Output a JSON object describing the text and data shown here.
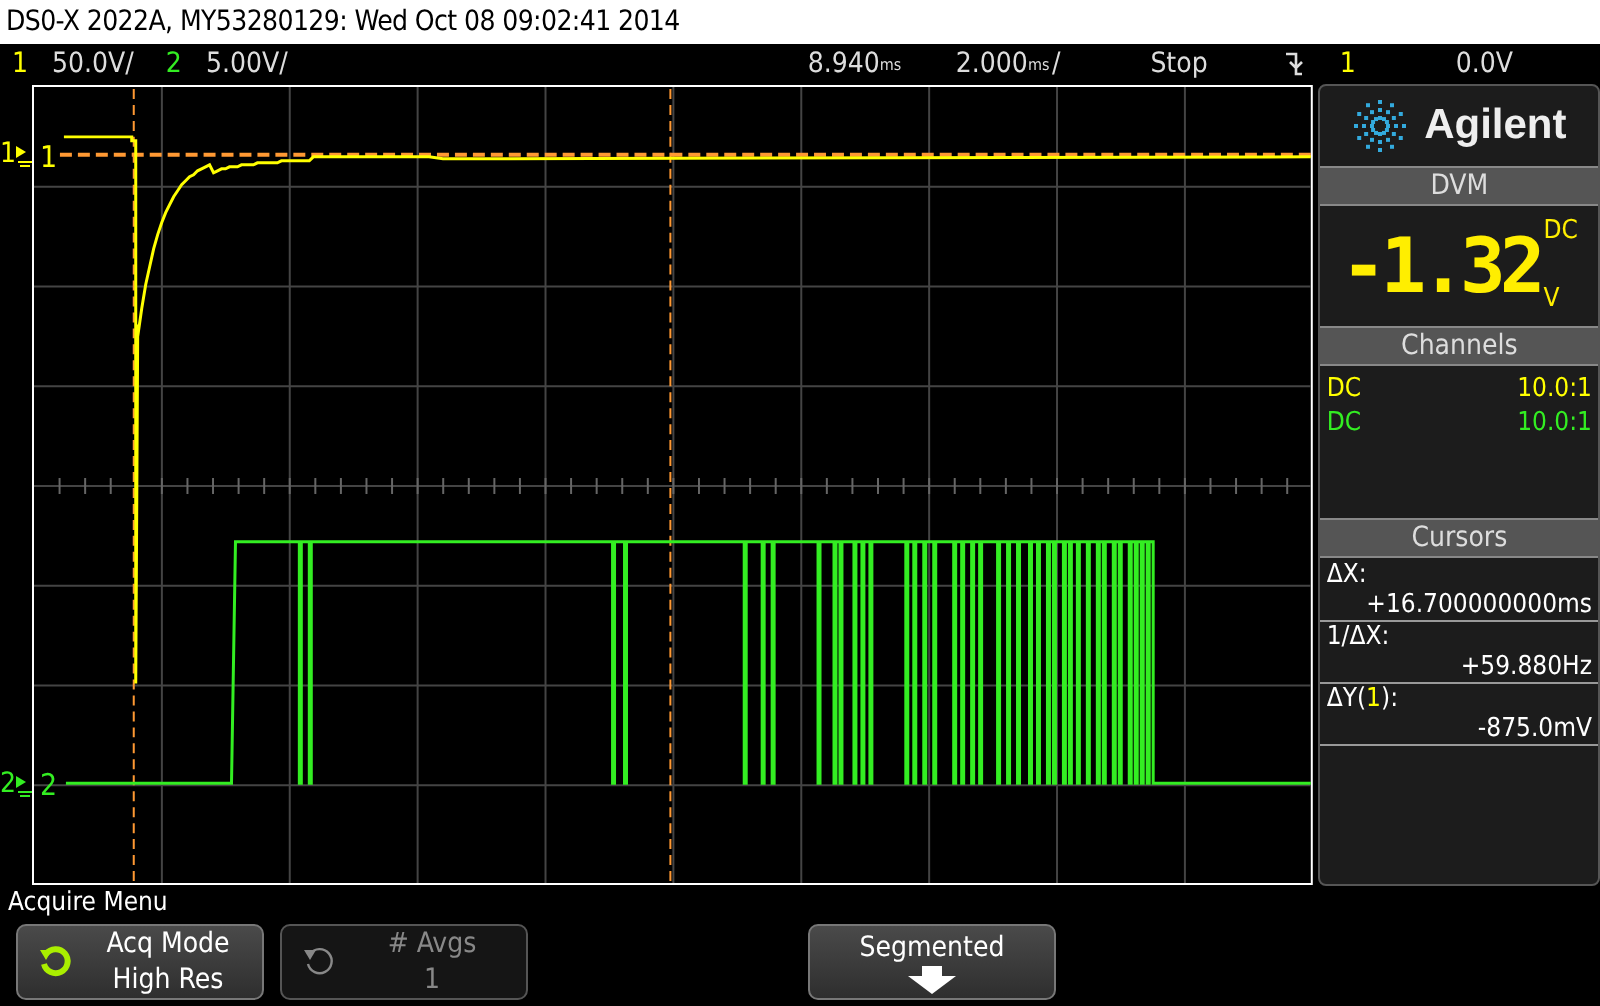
{
  "title_bar": "DS0-X 2022A, MY53280129: Wed Oct 08 09:02:41 2014",
  "status_bar": {
    "channels": [
      {
        "number": "1",
        "scale": "50.0V/",
        "color": "#ffff00"
      },
      {
        "number": "2",
        "scale": "5.00V/",
        "color": "#33ee22"
      }
    ],
    "delay": "8.940",
    "delay_unit": "ms",
    "timebase": "2.000",
    "timebase_unit": "ms",
    "timebase_suffix": "/",
    "run_state": "Stop",
    "trigger_source": "1",
    "trigger_level": "0.0V"
  },
  "traces": [
    {
      "gutter_label": "1",
      "screen_label": "1",
      "color": "#ffff00"
    },
    {
      "gutter_label": "2",
      "screen_label": "2",
      "color": "#33ee22"
    }
  ],
  "right_panel": {
    "logo": "Agilent",
    "dvm": {
      "title": "DVM",
      "reading": "-1.32",
      "coupling": "DC",
      "unit": "V"
    },
    "channels_title": "Channels",
    "channels": [
      {
        "coupling": "DC",
        "probe": "10.0:1",
        "color": "#ffff00"
      },
      {
        "coupling": "DC",
        "probe": "10.0:1",
        "color": "#33ee22"
      }
    ],
    "cursors_title": "Cursors",
    "cursors": [
      {
        "label": "ΔX:",
        "value": "+16.700000000ms"
      },
      {
        "label": "1/ΔX:",
        "value": "+59.880Hz"
      },
      {
        "label": "ΔY(",
        "source": "1",
        "label_end": "):",
        "value": "-875.0mV"
      }
    ]
  },
  "menu": {
    "title": "Acquire Menu",
    "softkeys": [
      {
        "kind": "cycle",
        "label": "Acq Mode",
        "value": "High Res",
        "disabled": false
      },
      {
        "kind": "cycle",
        "label": "# Avgs",
        "value": "1",
        "disabled": true
      },
      {
        "kind": "empty"
      },
      {
        "kind": "arrow",
        "label": "Segmented"
      },
      {
        "kind": "empty"
      },
      {
        "kind": "empty"
      }
    ]
  }
}
